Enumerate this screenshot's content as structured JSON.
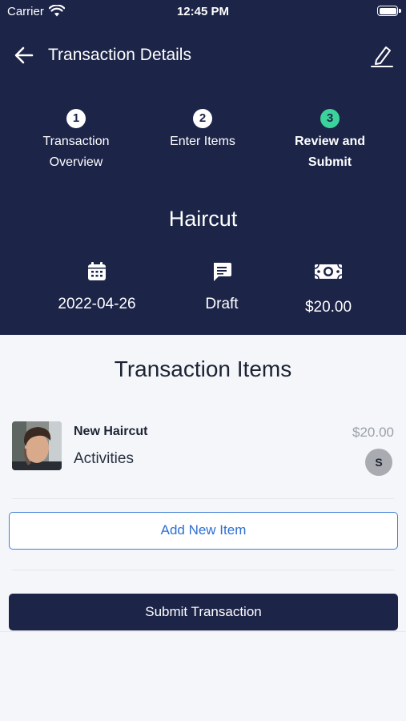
{
  "status_bar": {
    "carrier": "Carrier",
    "time": "12:45 PM"
  },
  "nav": {
    "title": "Transaction Details"
  },
  "steps": [
    {
      "number": "1",
      "label_line1": "Transaction",
      "label_line2": "Overview",
      "active": false
    },
    {
      "number": "2",
      "label_line1": "Enter Items",
      "label_line2": "",
      "active": false
    },
    {
      "number": "3",
      "label_line1": "Review and",
      "label_line2": "Submit",
      "active": true
    }
  ],
  "transaction": {
    "service": "Haircut",
    "date": "2022-04-26",
    "status": "Draft",
    "total": "$20.00"
  },
  "items_section": {
    "title": "Transaction Items"
  },
  "items": [
    {
      "name": "New Haircut",
      "category": "Activities",
      "price": "$20.00",
      "staff_initial": "S"
    }
  ],
  "buttons": {
    "add_item": "Add New Item",
    "submit": "Submit Transaction"
  },
  "colors": {
    "header_bg": "#1c2448",
    "active_step": "#3cd29b",
    "link_blue": "#2c6fd1"
  },
  "icons": {
    "back": "arrow-left-icon",
    "edit": "pencil-icon",
    "date": "calendar-icon",
    "status": "chat-bubble-icon",
    "total": "cash-icon"
  }
}
